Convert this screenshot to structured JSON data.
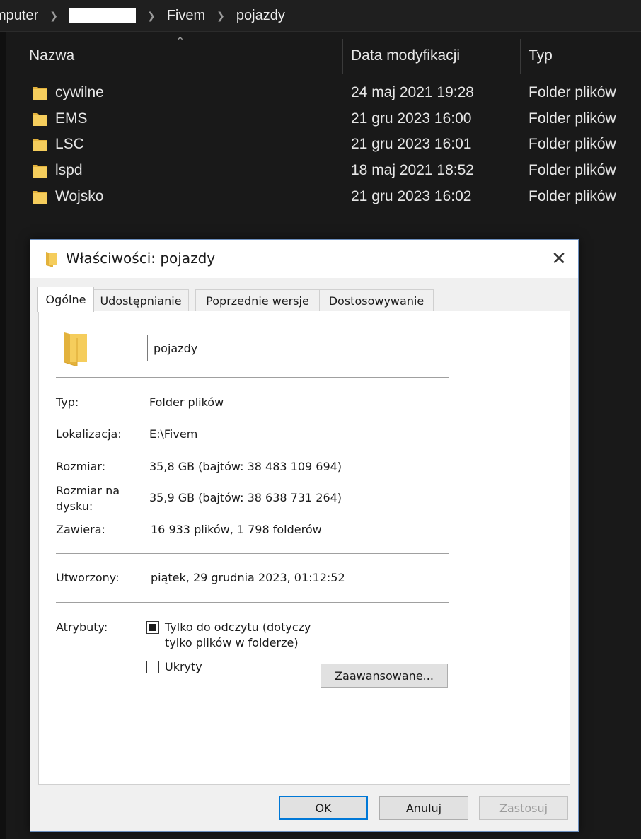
{
  "breadcrumb": {
    "items": [
      "mputer",
      "",
      "Fivem",
      "pojazdy"
    ]
  },
  "explorer": {
    "columns": {
      "name": "Nazwa",
      "date": "Data modyfikacji",
      "type": "Typ"
    },
    "rows": [
      {
        "name": "cywilne",
        "date": "24 maj 2021 19:28",
        "type": "Folder plików"
      },
      {
        "name": "EMS",
        "date": "21 gru 2023 16:00",
        "type": "Folder plików"
      },
      {
        "name": "LSC",
        "date": "21 gru 2023 16:01",
        "type": "Folder plików"
      },
      {
        "name": "lspd",
        "date": "18 maj 2021 18:52",
        "type": "Folder plików"
      },
      {
        "name": "Wojsko",
        "date": "21 gru 2023 16:02",
        "type": "Folder plików"
      }
    ]
  },
  "dialog": {
    "title": "Właściwości: pojazdy",
    "close_glyph": "✕",
    "tabs": [
      "Ogólne",
      "Udostępnianie",
      "Poprzednie wersje",
      "Dostosowywanie"
    ],
    "active_tab": "Ogólne",
    "name_value": "pojazdy",
    "fields": {
      "type_label": "Typ:",
      "type_value": "Folder plików",
      "location_label": "Lokalizacja:",
      "location_value": "E:\\Fivem",
      "size_label": "Rozmiar:",
      "size_value": "35,8 GB (bajtów: 38 483 109 694)",
      "size_on_disk_label_1": "Rozmiar na",
      "size_on_disk_label_2": "dysku:",
      "size_on_disk_value": "35,9 GB (bajtów: 38 638 731 264)",
      "contains_label": "Zawiera:",
      "contains_value": "16 933 plików, 1 798 folderów",
      "created_label": "Utworzony:",
      "created_value": "piątek, 29 grudnia 2023, 01:12:52",
      "attributes_label": "Atrybuty:"
    },
    "attributes": {
      "readonly_line1": "Tylko do odczytu (dotyczy",
      "readonly_line2": "tylko plików w folderze)",
      "readonly_state": "indeterminate",
      "hidden_label": "Ukryty",
      "hidden_state": "unchecked",
      "advanced_button": "Zaawansowane..."
    },
    "buttons": {
      "ok": "OK",
      "cancel": "Anuluj",
      "apply": "Zastosuj"
    },
    "colors": {
      "folder": "#f5cd5c",
      "folder_dark": "#e3b23c",
      "ok_border": "#0078d7"
    }
  }
}
